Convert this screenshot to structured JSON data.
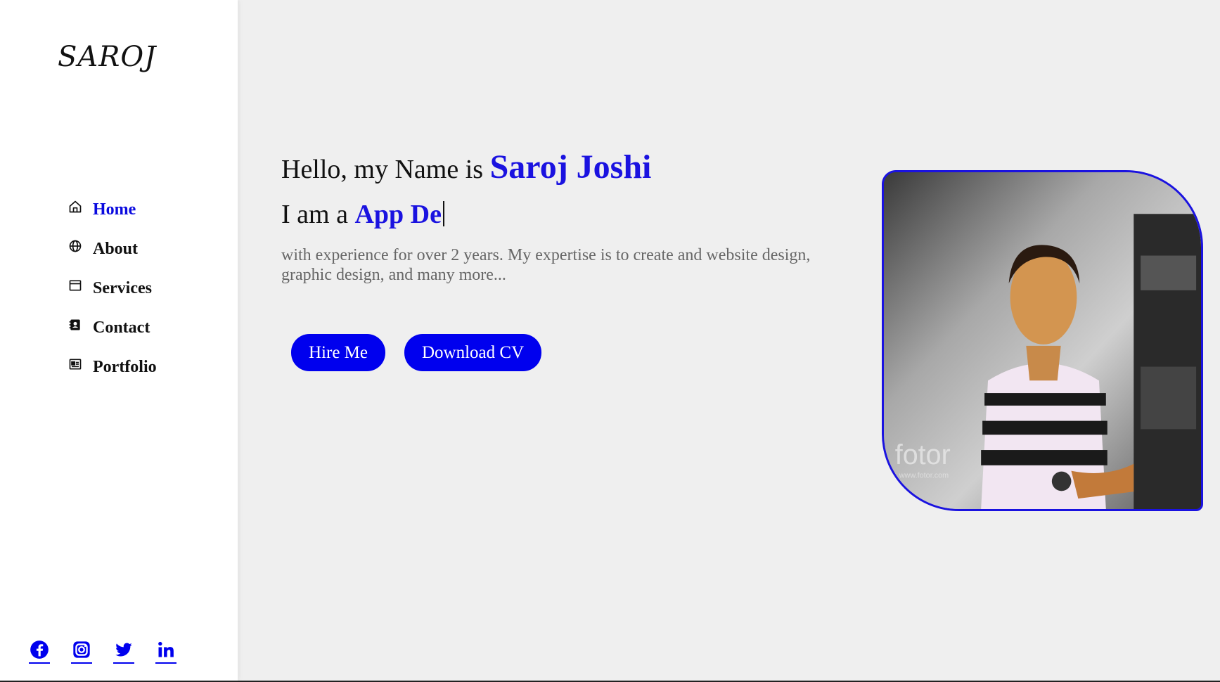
{
  "sidebar": {
    "logo": "SAROJ",
    "nav": [
      {
        "label": "Home",
        "icon": "home-icon",
        "active": true
      },
      {
        "label": "About",
        "icon": "globe-icon",
        "active": false
      },
      {
        "label": "Services",
        "icon": "browser-window-icon",
        "active": false
      },
      {
        "label": "Contact",
        "icon": "contact-book-icon",
        "active": false
      },
      {
        "label": "Portfolio",
        "icon": "newspaper-icon",
        "active": false
      }
    ],
    "social": [
      "facebook-icon",
      "instagram-icon",
      "twitter-icon",
      "linkedin-icon"
    ]
  },
  "hero": {
    "greeting": "Hello, my Name is ",
    "name": "Saroj Joshi",
    "role_prefix": "I am a ",
    "role_typed": "App De",
    "description": "with experience for over 2 years. My expertise is to create and website design, graphic design, and many more...",
    "hire_button": "Hire Me",
    "cv_button": "Download CV"
  },
  "photo": {
    "watermark": "fotor",
    "watermark_url": "www.fotor.com"
  },
  "colors": {
    "accent": "#1a12e0",
    "button": "#0000ee",
    "background": "#efefef",
    "sidebar": "#ffffff"
  }
}
